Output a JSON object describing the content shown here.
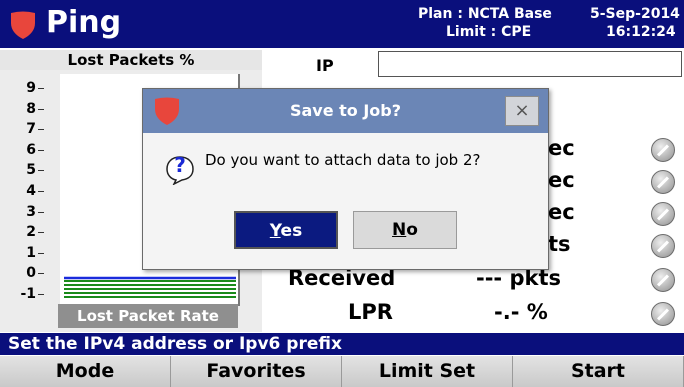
{
  "header": {
    "title": "Ping",
    "plan_text": "Plan : NCTA Base",
    "limit_text": "Limit : CPE",
    "date": "5-Sep-2014",
    "time": "16:12:24",
    "logo_icon": "shield-logo-icon",
    "colors": {
      "bar": "#0a0f7c",
      "logo": "#e8463c"
    }
  },
  "chart": {
    "title": "Lost Packets %",
    "yticks": [
      "9",
      "8",
      "7",
      "6",
      "5",
      "4",
      "3",
      "2",
      "1",
      "0",
      "-1"
    ],
    "footer_label": "Lost Packet Rate"
  },
  "chart_data": {
    "type": "line",
    "title": "Lost Packets %",
    "ylim": [
      -1,
      9
    ],
    "series": [
      {
        "color": "#1a2bdc",
        "values": [
          0
        ]
      },
      {
        "color": "#1a8a1a",
        "values": [
          -0.15,
          -0.35,
          -0.55,
          -0.75,
          -0.95
        ]
      }
    ]
  },
  "ip": {
    "label": "IP",
    "value": ""
  },
  "rows": [
    {
      "label": "",
      "value": "ec"
    },
    {
      "label": "",
      "value": "ec"
    },
    {
      "label": "",
      "value": "ec"
    },
    {
      "label": "",
      "value": "ts"
    },
    {
      "label": "Received",
      "value": "--- pkts"
    },
    {
      "label": "LPR",
      "value": "-.- %"
    }
  ],
  "dialog": {
    "title": "Save to Job?",
    "close_label": "×",
    "message": "Do you want to attach data to job 2?",
    "question_icon": "?",
    "yes_underlined": "Y",
    "yes_rest": "es",
    "no_underlined": "N",
    "no_rest": "o"
  },
  "status_bar": {
    "text": "Set the IPv4 address or Ipv6 prefix"
  },
  "softkeys": [
    "Mode",
    "Favorites",
    "Limit Set",
    "Start"
  ]
}
